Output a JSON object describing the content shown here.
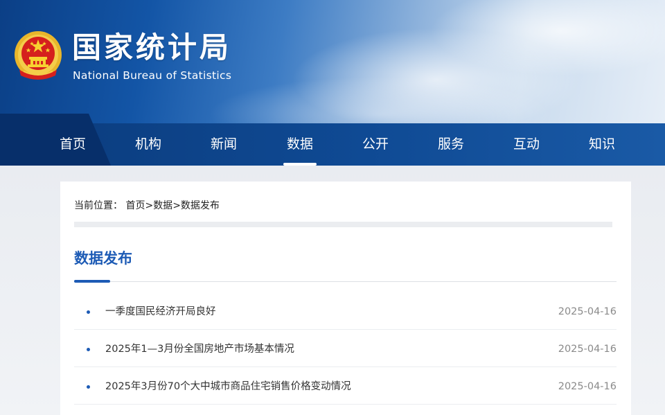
{
  "header": {
    "title_cn": "国家统计局",
    "title_en": "National Bureau of Statistics"
  },
  "nav": {
    "items": [
      {
        "label": "首页"
      },
      {
        "label": "机构"
      },
      {
        "label": "新闻"
      },
      {
        "label": "数据"
      },
      {
        "label": "公开"
      },
      {
        "label": "服务"
      },
      {
        "label": "互动"
      },
      {
        "label": "知识"
      }
    ],
    "active": "数据"
  },
  "breadcrumb": {
    "prefix": "当前位置：",
    "items": [
      "首页",
      "数据",
      "数据发布"
    ],
    "separator": ">"
  },
  "section": {
    "title": "数据发布"
  },
  "news": [
    {
      "title": "一季度国民经济开局良好",
      "date": "2025-04-16"
    },
    {
      "title": "2025年1—3月份全国房地产市场基本情况",
      "date": "2025-04-16"
    },
    {
      "title": "2025年3月份70个大中城市商品住宅销售价格变动情况",
      "date": "2025-04-16"
    }
  ],
  "colors": {
    "brand_blue": "#1d5bb5",
    "nav_blue": "#0f4a94",
    "emblem_red": "#d5201d",
    "emblem_gold": "#f2c230"
  },
  "icons": {
    "emblem": "national-emblem-icon",
    "bullet": "bullet-dot-icon"
  }
}
